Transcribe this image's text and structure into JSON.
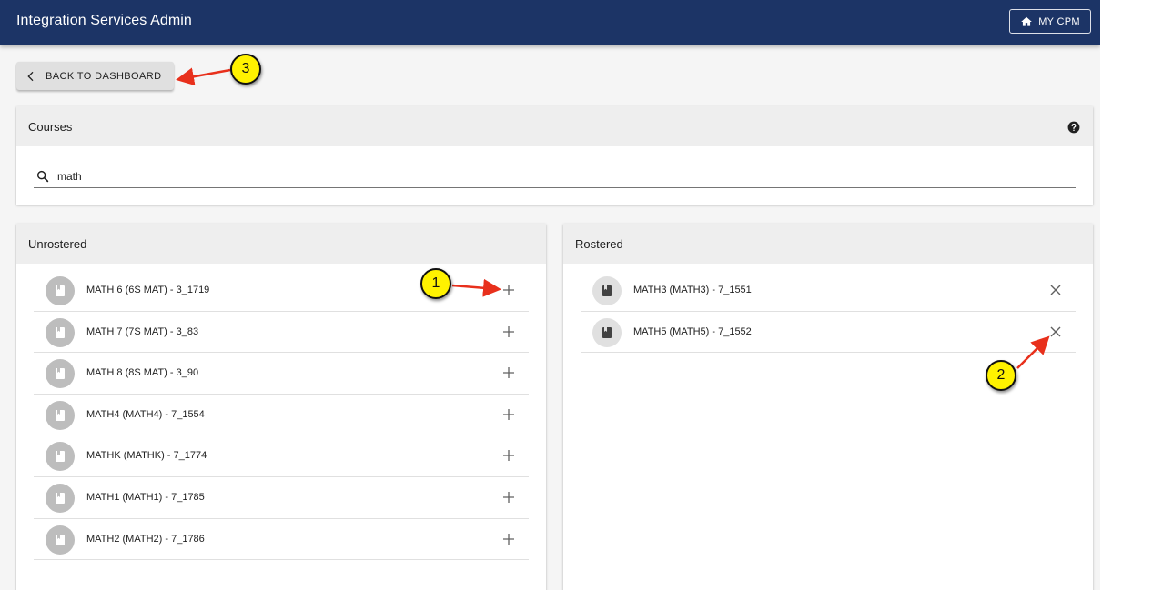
{
  "header": {
    "title": "Integration Services Admin",
    "my_cpm_label": "MY CPM"
  },
  "back_button": {
    "label": "BACK TO DASHBOARD"
  },
  "courses": {
    "title": "Courses",
    "search_value": "math"
  },
  "unrostered": {
    "title": "Unrostered",
    "items": [
      {
        "label": "MATH 6 (6S MAT) - 3_1719"
      },
      {
        "label": "MATH 7 (7S MAT) - 3_83"
      },
      {
        "label": "MATH 8 (8S MAT) - 3_90"
      },
      {
        "label": "MATH4 (MATH4) - 7_1554"
      },
      {
        "label": "MATHK (MATHK) - 7_1774"
      },
      {
        "label": "MATH1 (MATH1) - 7_1785"
      },
      {
        "label": "MATH2 (MATH2) - 7_1786"
      }
    ]
  },
  "rostered": {
    "title": "Rostered",
    "items": [
      {
        "label": "MATH3 (MATH3) - 7_1551"
      },
      {
        "label": "MATH5 (MATH5) - 7_1552"
      }
    ]
  },
  "callouts": [
    "1",
    "2",
    "3"
  ],
  "colors": {
    "appbar": "#1c3466",
    "callout": "#fff200",
    "arrow": "#e8301c"
  },
  "icons": {
    "home": "home-icon",
    "back": "chevron-left-icon",
    "help": "help-circle-icon",
    "search": "search-icon",
    "book": "book-icon",
    "add": "plus-icon",
    "remove": "close-icon"
  }
}
